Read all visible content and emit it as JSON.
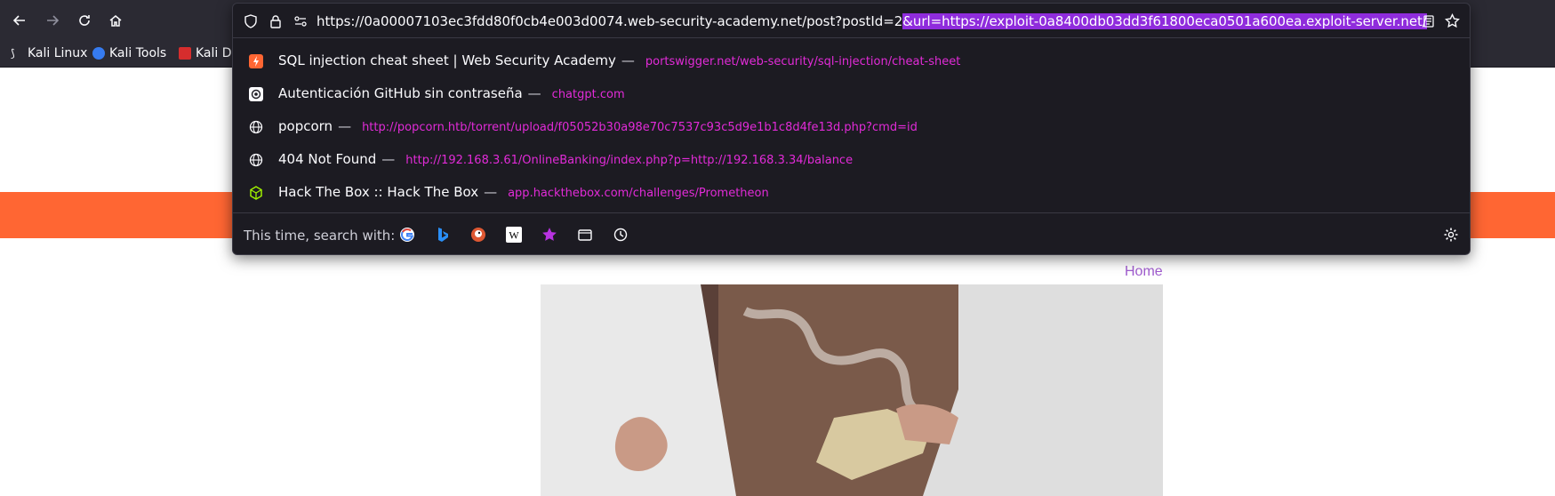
{
  "browser": {
    "url_prefix": "https://0a00007103ec3fdd80f0cb4e003d0074.web-security-academy.net/post?postId=2",
    "url_selected": "&url=https://exploit-0a8400db03dd3f61800eca0501a600ea.exploit-server.net/",
    "bookmarks": [
      {
        "label": "Kali Linux",
        "icon": "kali-dragon-icon"
      },
      {
        "label": "Kali Tools",
        "icon": "kali-tools-icon"
      },
      {
        "label": "Kali Do",
        "icon": "kali-docs-icon"
      }
    ]
  },
  "suggestions": [
    {
      "title": "SQL injection cheat sheet | Web Security Academy",
      "url": "portswigger.net/web-security/sql-injection/cheat-sheet",
      "icon": "portswigger-icon"
    },
    {
      "title": "Autenticación GitHub sin contraseña",
      "url": "chatgpt.com",
      "icon": "chatgpt-icon"
    },
    {
      "title": "popcorn",
      "url": "http://popcorn.htb/torrent/upload/f05052b30a98e70c7537c93c5d9e1b1c8d4fe13d.php?cmd=id",
      "icon": "globe-icon"
    },
    {
      "title": "404 Not Found",
      "url": "http://192.168.3.61/OnlineBanking/index.php?p=http://192.168.3.34/balance",
      "icon": "globe-icon"
    },
    {
      "title": "Hack The Box :: Hack The Box",
      "url": "app.hackthebox.com/challenges/Prometheon",
      "icon": "htb-cube-icon"
    }
  ],
  "search_with": {
    "label": "This time, search with:",
    "engines": [
      "google-icon",
      "bing-icon",
      "duckduckgo-icon",
      "wikipedia-icon",
      "bookmarks-star-icon",
      "tabs-icon",
      "history-icon"
    ]
  },
  "page": {
    "home_link": "Home"
  },
  "colors": {
    "banner": "#ff6633",
    "url_highlight": "#8f2cdc",
    "suggestion_url": "#e22bd8"
  }
}
